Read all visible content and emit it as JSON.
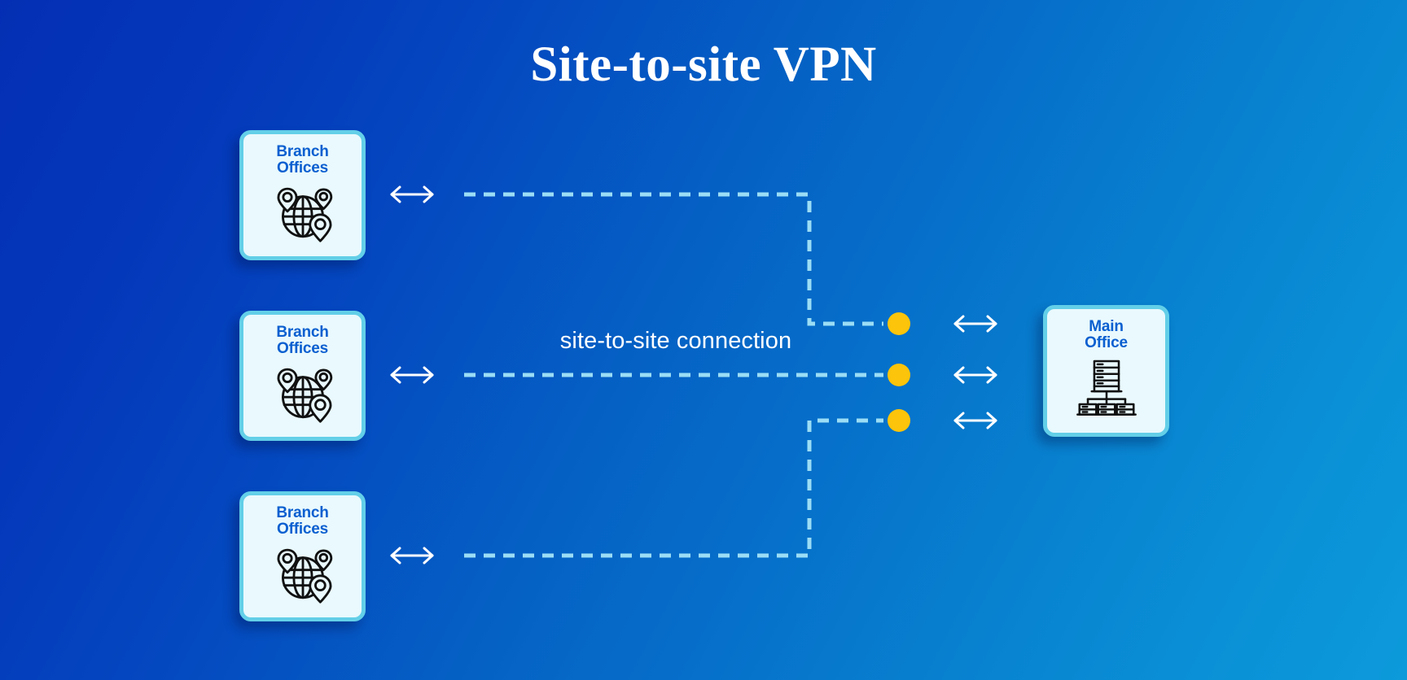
{
  "page": {
    "title": "Site-to-site VPN",
    "background": {
      "from": "#042fb4",
      "to": "#0c9adb"
    }
  },
  "diagram": {
    "type": "network-topology",
    "connection_label": "site-to-site connection",
    "colors": {
      "card_fill": "#e9f9fd",
      "card_border": "#63cfe8",
      "card_text": "#0a5fd0",
      "dashed_line": "#9bddf5",
      "endpoint_dot": "#fcc40a",
      "arrow": "#ffffff"
    },
    "branch_nodes": [
      {
        "id": "branch-1",
        "title_line_1": "Branch",
        "title_line_2": "Offices",
        "icon": "globe-location-pins-icon"
      },
      {
        "id": "branch-2",
        "title_line_1": "Branch",
        "title_line_2": "Offices",
        "icon": "globe-location-pins-icon"
      },
      {
        "id": "branch-3",
        "title_line_1": "Branch",
        "title_line_2": "Offices",
        "icon": "globe-location-pins-icon"
      }
    ],
    "hub_node": {
      "id": "main-office",
      "title_line_1": "Main",
      "title_line_2": "Office",
      "icon": "server-rack-network-icon"
    },
    "links": [
      {
        "id": "link-1",
        "from": "branch-1",
        "to": "main-office",
        "style": "dashed",
        "endpoint": "dot"
      },
      {
        "id": "link-2",
        "from": "branch-2",
        "to": "main-office",
        "style": "dashed",
        "endpoint": "dot"
      },
      {
        "id": "link-3",
        "from": "branch-3",
        "to": "main-office",
        "style": "dashed",
        "endpoint": "dot"
      }
    ],
    "arrows": [
      {
        "id": "arrow-branch-1",
        "icon": "double-headed-arrow-icon"
      },
      {
        "id": "arrow-branch-2",
        "icon": "double-headed-arrow-icon"
      },
      {
        "id": "arrow-branch-3",
        "icon": "double-headed-arrow-icon"
      },
      {
        "id": "arrow-hub-1",
        "icon": "double-headed-arrow-icon"
      },
      {
        "id": "arrow-hub-2",
        "icon": "double-headed-arrow-icon"
      },
      {
        "id": "arrow-hub-3",
        "icon": "double-headed-arrow-icon"
      }
    ]
  }
}
